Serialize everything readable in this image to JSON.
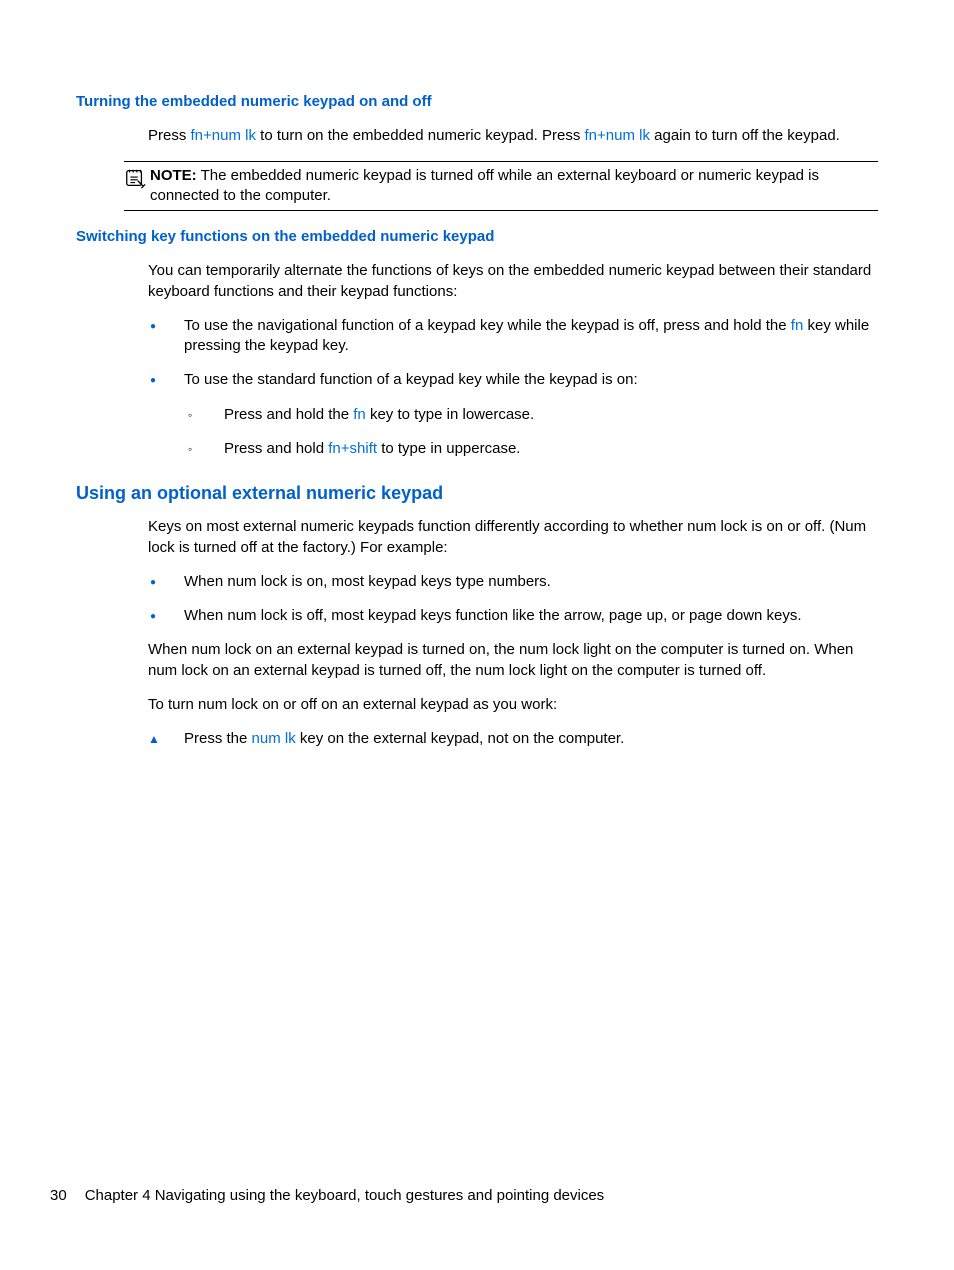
{
  "section1": {
    "heading": "Turning the embedded numeric keypad on and off",
    "para_parts": {
      "p1a": "Press ",
      "fn1": "fn",
      "plus1": "+",
      "numlk1": "num lk",
      "p1b": " to turn on the embedded numeric keypad. Press ",
      "fn2": "fn",
      "plus2": "+",
      "numlk2": "num lk",
      "p1c": " again to turn off the keypad."
    },
    "note_label": "NOTE:",
    "note_text": "   The embedded numeric keypad is turned off while an external keyboard or numeric keypad is connected to the computer."
  },
  "section2": {
    "heading": "Switching key functions on the embedded numeric keypad",
    "intro": "You can temporarily alternate the functions of keys on the embedded numeric keypad between their standard keyboard functions and their keypad functions:",
    "b1": {
      "a": "To use the navigational function of a keypad key while the keypad is off, press and hold the ",
      "fn": "fn",
      "b": " key while pressing the keypad key."
    },
    "b2": "To use the standard function of a keypad key while the keypad is on:",
    "s1": {
      "a": "Press and hold the ",
      "fn": "fn",
      "b": " key to type in lowercase."
    },
    "s2": {
      "a": "Press and hold ",
      "fn": "fn",
      "plus": "+",
      "shift": "shift",
      "b": " to type in uppercase."
    }
  },
  "section3": {
    "heading": "Using an optional external numeric keypad",
    "intro": "Keys on most external numeric keypads function differently according to whether num lock is on or off. (Num lock is turned off at the factory.) For example:",
    "b1": "When num lock is on, most keypad keys type numbers.",
    "b2": "When num lock is off, most keypad keys function like the arrow, page up, or page down keys.",
    "p2": "When num lock on an external keypad is turned on, the num lock light on the computer is turned on. When num lock on an external keypad is turned off, the num lock light on the computer is turned off.",
    "p3": "To turn num lock on or off on an external keypad as you work:",
    "t1": {
      "a": "Press the ",
      "numlk": "num lk",
      "b": " key on the external keypad, not on the computer."
    }
  },
  "footer": {
    "page": "30",
    "chapter": "Chapter 4   Navigating using the keyboard, touch gestures and pointing devices"
  }
}
